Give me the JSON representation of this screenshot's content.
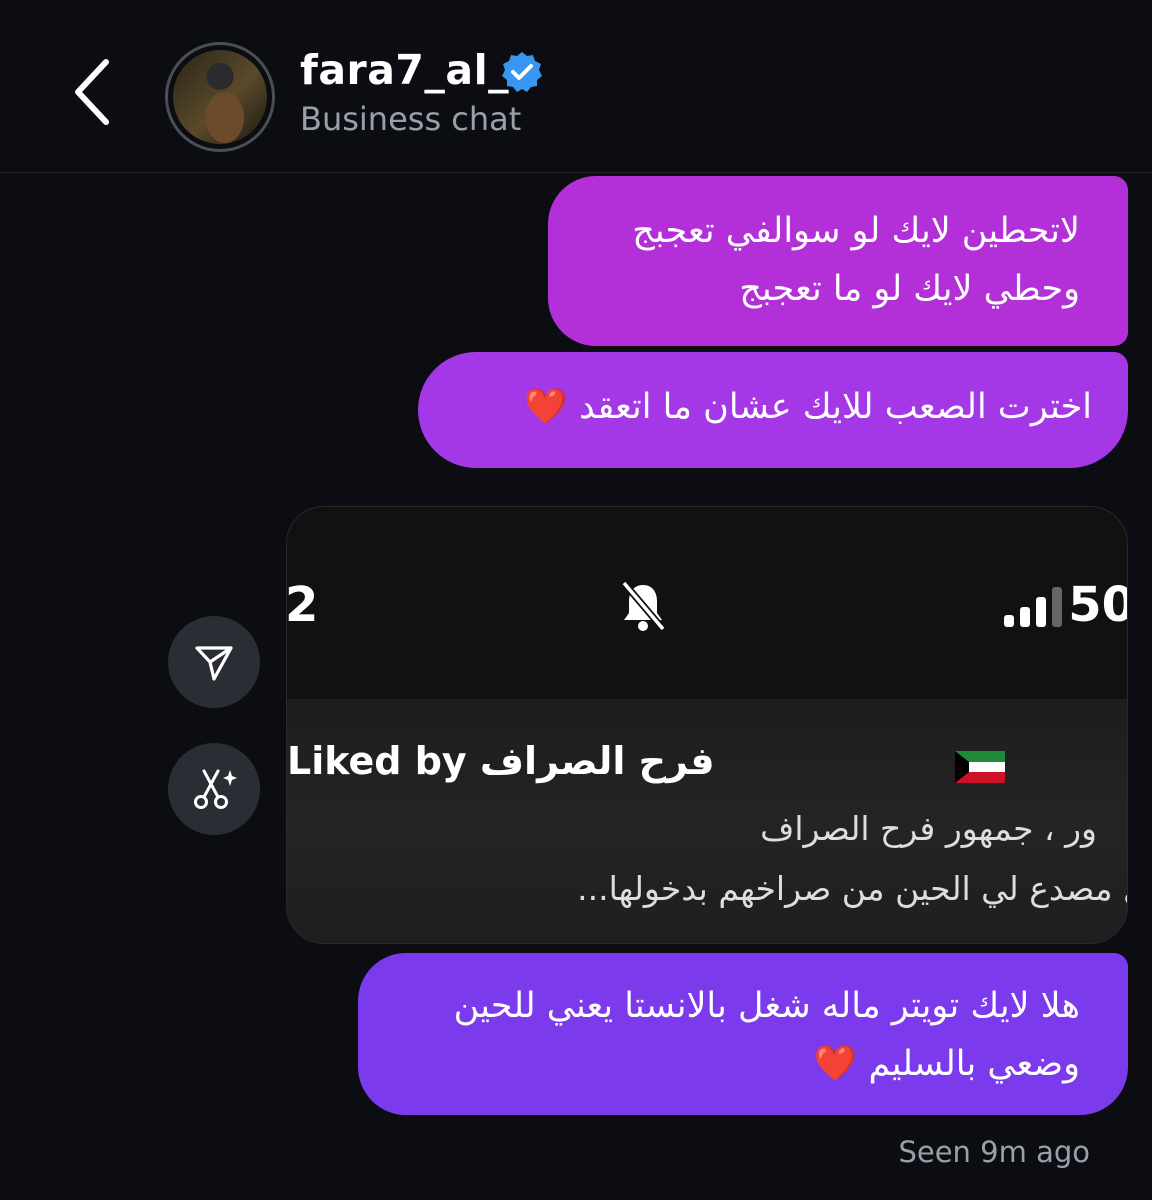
{
  "header": {
    "username": "fara7_al_",
    "subtitle": "Business chat",
    "verified": true,
    "back_icon": "chevron-left-icon",
    "verified_icon": "verified-badge-icon"
  },
  "messages": [
    {
      "lines": [
        "لاتحطين لايك لو سوالفي تعجبج",
        "وحطي لايك لو ما تعجبج"
      ],
      "color": "#b330d8"
    },
    {
      "text": "اخترت الصعب للايك عشان ما اتعقد",
      "emoji": "❤️",
      "color": "#a437e6"
    },
    {
      "type": "screenshot",
      "status_left": "2",
      "status_right": "50",
      "liked_by_label": "Liked by",
      "liked_name": "فرح الصراف",
      "flag_icon": "kuwait-flag-icon",
      "line1": "ور ، جمهور فرح الصراف",
      "line2": "ل مصدع لي الحين من صراخهم بدخولها..."
    },
    {
      "lines": [
        "هلا لايك تويتر ماله شغل بالانستا يعني للحين",
        "وضعي بالسليم"
      ],
      "emoji": "❤️",
      "color": "#7c3aed"
    }
  ],
  "actions": {
    "share_icon": "send-icon",
    "edit_icon": "scissors-sparkle-icon"
  },
  "seen_status": "Seen 9m ago",
  "colors": {
    "background": "#0b0d12",
    "verified": "#3797f0",
    "heart": "#e0202a"
  }
}
